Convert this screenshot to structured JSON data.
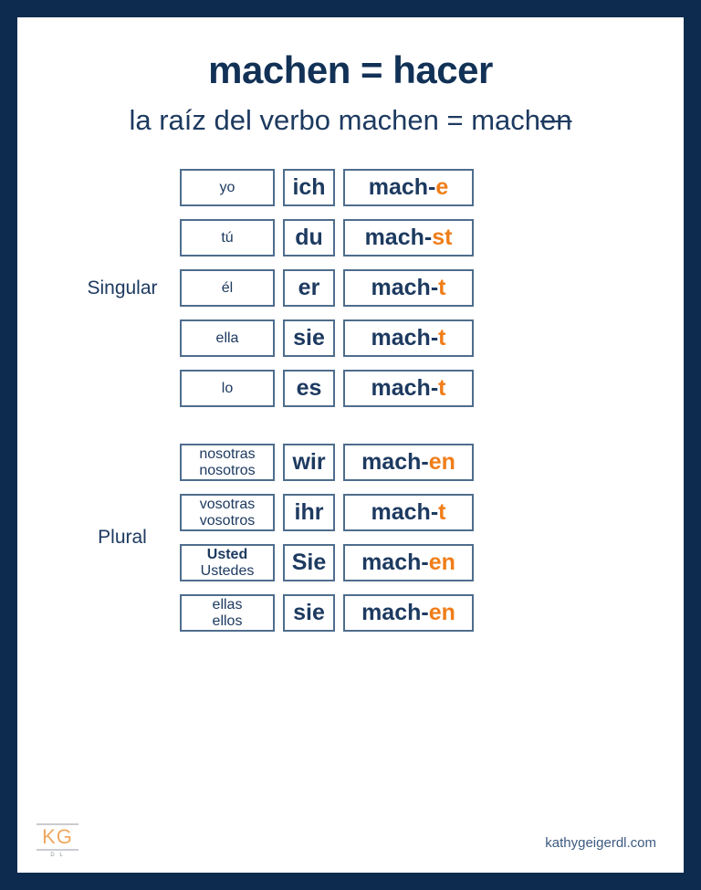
{
  "title": "machen = hacer",
  "subtitle": {
    "prefix": "la raíz del verbo machen = mach",
    "struck": "en"
  },
  "colors": {
    "border_navy": "#0d2b4f",
    "text_navy": "#1d3a60",
    "accent_orange": "#f07d18",
    "cell_border": "#4e6d8d",
    "logo_orange": "#f0a860"
  },
  "sections": [
    {
      "label": "Singular",
      "rows": [
        {
          "es_line1": "yo",
          "es_line2": "",
          "es_bold_line1": false,
          "de": "ich",
          "stem": "mach-",
          "ending": "e"
        },
        {
          "es_line1": "tú",
          "es_line2": "",
          "es_bold_line1": false,
          "de": "du",
          "stem": "mach-",
          "ending": "st"
        },
        {
          "es_line1": "él",
          "es_line2": "",
          "es_bold_line1": false,
          "de": "er",
          "stem": "mach-",
          "ending": "t"
        },
        {
          "es_line1": "ella",
          "es_line2": "",
          "es_bold_line1": false,
          "de": "sie",
          "stem": "mach-",
          "ending": "t"
        },
        {
          "es_line1": "lo",
          "es_line2": "",
          "es_bold_line1": false,
          "de": "es",
          "stem": "mach-",
          "ending": "t"
        }
      ]
    },
    {
      "label": "Plural",
      "rows": [
        {
          "es_line1": "nosotras",
          "es_line2": "nosotros",
          "es_bold_line1": false,
          "de": "wir",
          "stem": "mach-",
          "ending": "en"
        },
        {
          "es_line1": "vosotras",
          "es_line2": "vosotros",
          "es_bold_line1": false,
          "de": "ihr",
          "stem": "mach-",
          "ending": "t"
        },
        {
          "es_line1": "Usted",
          "es_line2": "Ustedes",
          "es_bold_line1": true,
          "de": "Sie",
          "stem": "mach-",
          "ending": "en"
        },
        {
          "es_line1": "ellas",
          "es_line2": "ellos",
          "es_bold_line1": false,
          "de": "sie",
          "stem": "mach-",
          "ending": "en"
        }
      ]
    }
  ],
  "footer": {
    "logo_initials": "KG",
    "logo_sub": "D L",
    "website": "kathygeigerdl.com"
  }
}
